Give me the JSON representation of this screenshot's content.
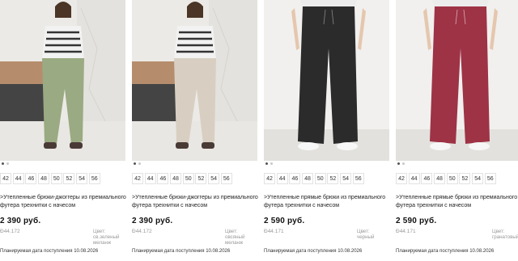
{
  "products": [
    {
      "sizes": [
        "42",
        "44",
        "46",
        "48",
        "50",
        "52",
        "54",
        "56"
      ],
      "title": ">Утепленные брюки-джоггеры из премиального футера трехнитки с начесом",
      "price": "2 390 руб.",
      "article": "Ð44.172",
      "color_label": "Цвет:",
      "color_value": "св.зеленый меланж",
      "delivery": "Планируемая дата поступления 10.08.2026",
      "pants_color": "#9aaa82",
      "top_color": "#f2f2f2"
    },
    {
      "sizes": [
        "42",
        "44",
        "46",
        "48",
        "50",
        "52",
        "54",
        "56"
      ],
      "title": ">Утепленные брюки-джоггеры из премиального футера трехнитки с начесом",
      "price": "2 390 руб.",
      "article": "Ð44.172",
      "color_label": "Цвет:",
      "color_value": "овсяный меланж",
      "delivery": "Планируемая дата поступления 10.08.2026",
      "pants_color": "#d8cfc2",
      "top_color": "#f2f2f2"
    },
    {
      "sizes": [
        "42",
        "44",
        "46",
        "48",
        "50",
        "52",
        "54",
        "56"
      ],
      "title": ">Утепленные прямые брюки из премиального футера трехнитки с начесом",
      "price": "2 590 руб.",
      "article": "Ð44.171",
      "color_label": "Цвет:",
      "color_value": "черный",
      "delivery": "Планируемая дата поступления 10.08.2026",
      "pants_color": "#2b2b2b",
      "top_color": "#ececec"
    },
    {
      "sizes": [
        "42",
        "44",
        "46",
        "48",
        "50",
        "52",
        "54",
        "56"
      ],
      "title": ">Утепленные прямые брюки из премиального футера трехнитки с начесом",
      "price": "2 590 руб.",
      "article": "Ð44.171",
      "color_label": "Цвет:",
      "color_value": "гранатовый",
      "delivery": "Планируемая дата поступления 10.08.2026",
      "pants_color": "#9e3346",
      "top_color": "#ececec"
    }
  ]
}
